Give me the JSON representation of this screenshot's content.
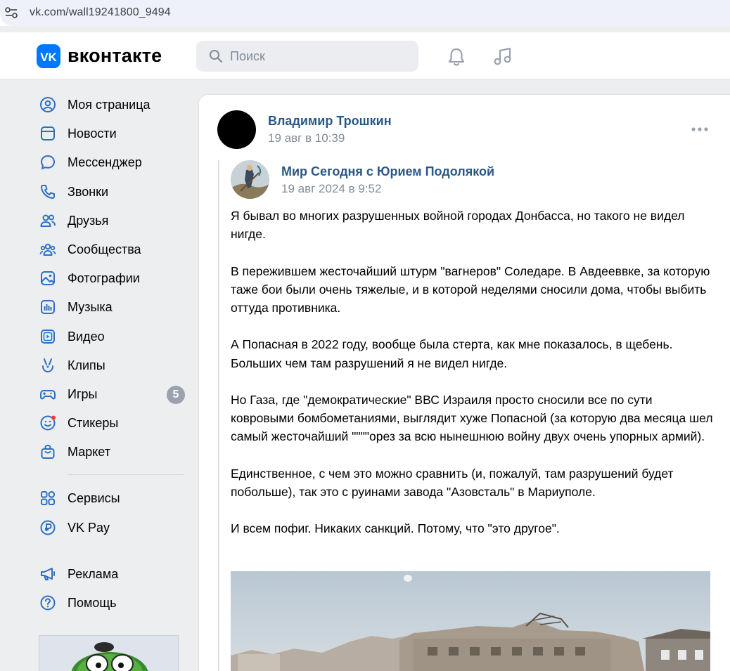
{
  "browser": {
    "url": "vk.com/wall19241800_9494"
  },
  "header": {
    "logo_text": "вконтакте",
    "search_placeholder": "Поиск"
  },
  "sidebar": {
    "items": [
      {
        "label": "Моя страница",
        "icon": "profile-icon"
      },
      {
        "label": "Новости",
        "icon": "news-icon"
      },
      {
        "label": "Мессенджер",
        "icon": "messenger-icon"
      },
      {
        "label": "Звонки",
        "icon": "phone-icon"
      },
      {
        "label": "Друзья",
        "icon": "friends-icon"
      },
      {
        "label": "Сообщества",
        "icon": "communities-icon"
      },
      {
        "label": "Фотографии",
        "icon": "photos-icon"
      },
      {
        "label": "Музыка",
        "icon": "music-icon"
      },
      {
        "label": "Видео",
        "icon": "video-icon"
      },
      {
        "label": "Клипы",
        "icon": "clips-icon"
      },
      {
        "label": "Игры",
        "icon": "games-icon",
        "badge": "5"
      },
      {
        "label": "Стикеры",
        "icon": "stickers-icon"
      },
      {
        "label": "Маркет",
        "icon": "market-icon"
      }
    ],
    "items2": [
      {
        "label": "Сервисы",
        "icon": "services-icon"
      },
      {
        "label": "VK Pay",
        "icon": "vkpay-icon"
      }
    ],
    "items3": [
      {
        "label": "Реклама",
        "icon": "ads-icon"
      },
      {
        "label": "Помощь",
        "icon": "help-icon"
      }
    ]
  },
  "post": {
    "author": "Владимир Трошкин",
    "date": "19 авг в 10:39",
    "repost": {
      "author": "Мир Сегодня с Юрием Подолякой",
      "date": "19 авг 2024 в 9:52",
      "paragraphs": [
        "Я бывал во многих разрушенных войной городах Донбасса, но такого не видел нигде.",
        "В пережившем жесточайший штурм \"вагнеров\" Соледаре. В Авдееввке, за которую таже бои были очень тяжелые, и в которой неделями сносили дома, чтобы выбить оттуда противника.",
        "А Попасная в 2022 году, вообще была стерта, как мне показалось, в щебень. Больших чем там разрушений я не видел нигде.",
        "Но Газа, где \"демократические\" ВВС Израиля просто сносили все по сути ковровыми бомбометаниями, выглядит хуже Попасной (за которую два месяца шел самый жесточайший \"\"\"\"орез за всю нынешнюю войну двух очень упорных армий).",
        "Единственное, с чем это можно сравнить (и, пожалуй, там разрушений будет побольше), так это с руинами завода \"Азовсталь\" в Мариуполе.",
        "И всем пофиг. Никаких санкций. Потому, что \"это другое\"."
      ]
    }
  },
  "colors": {
    "accent": "#0077ff",
    "link": "#2a5885",
    "muted": "#818c99",
    "icon": "#2f6fbf"
  }
}
